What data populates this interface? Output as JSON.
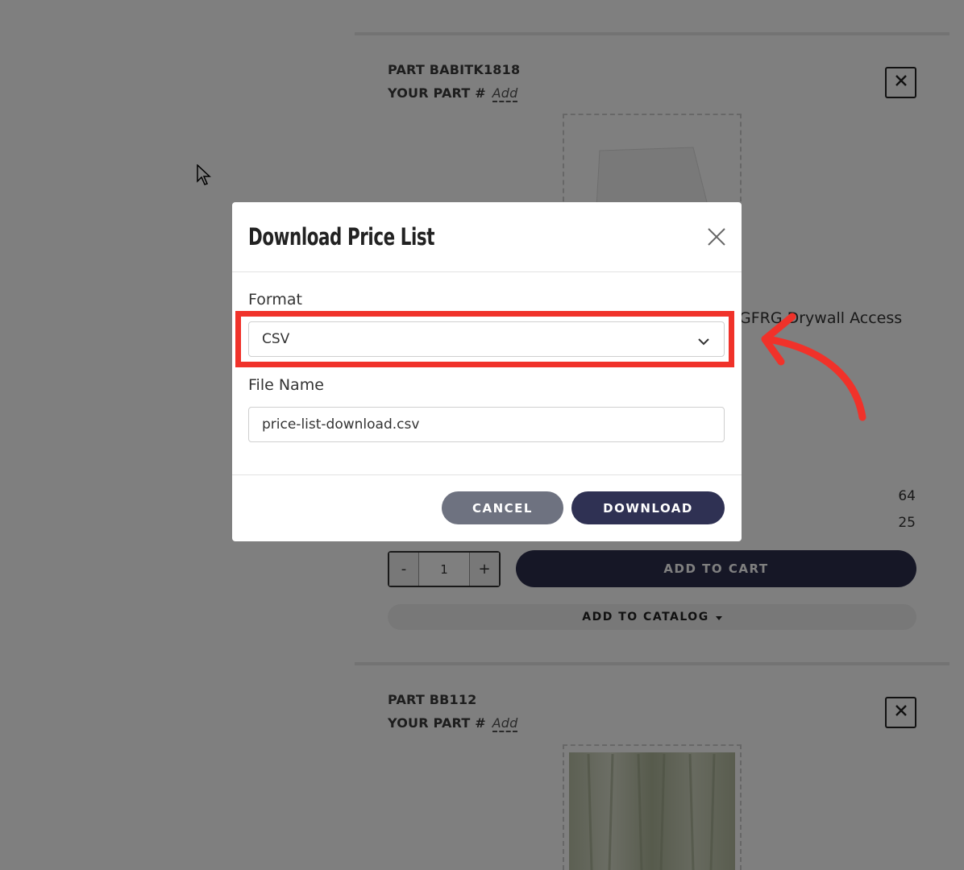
{
  "background": {
    "parts": [
      {
        "part_label": "PART BABITK1818",
        "your_part_label": "YOUR PART #",
        "add_link": "Add"
      },
      {
        "part_label": "PART BB112",
        "your_part_label": "YOUR PART #",
        "add_link": "Add"
      }
    ],
    "product_title_fragment": "GFRG Drywall Access",
    "stats": [
      "64",
      "25"
    ],
    "quantity": "1",
    "minus_label": "-",
    "plus_label": "+",
    "add_to_cart_label": "ADD TO CART",
    "add_to_catalog_label": "ADD TO CATALOG",
    "remove_glyph": "✕"
  },
  "modal": {
    "title": "Download Price List",
    "close_glyph": "✕",
    "format_label": "Format",
    "format_value": "CSV",
    "file_name_label": "File Name",
    "file_name_value": "price-list-download.csv",
    "cancel_label": "CANCEL",
    "download_label": "DOWNLOAD"
  },
  "colors": {
    "highlight": "#f0322a",
    "primary_button": "#2f3153",
    "secondary_button": "#6e7280"
  }
}
